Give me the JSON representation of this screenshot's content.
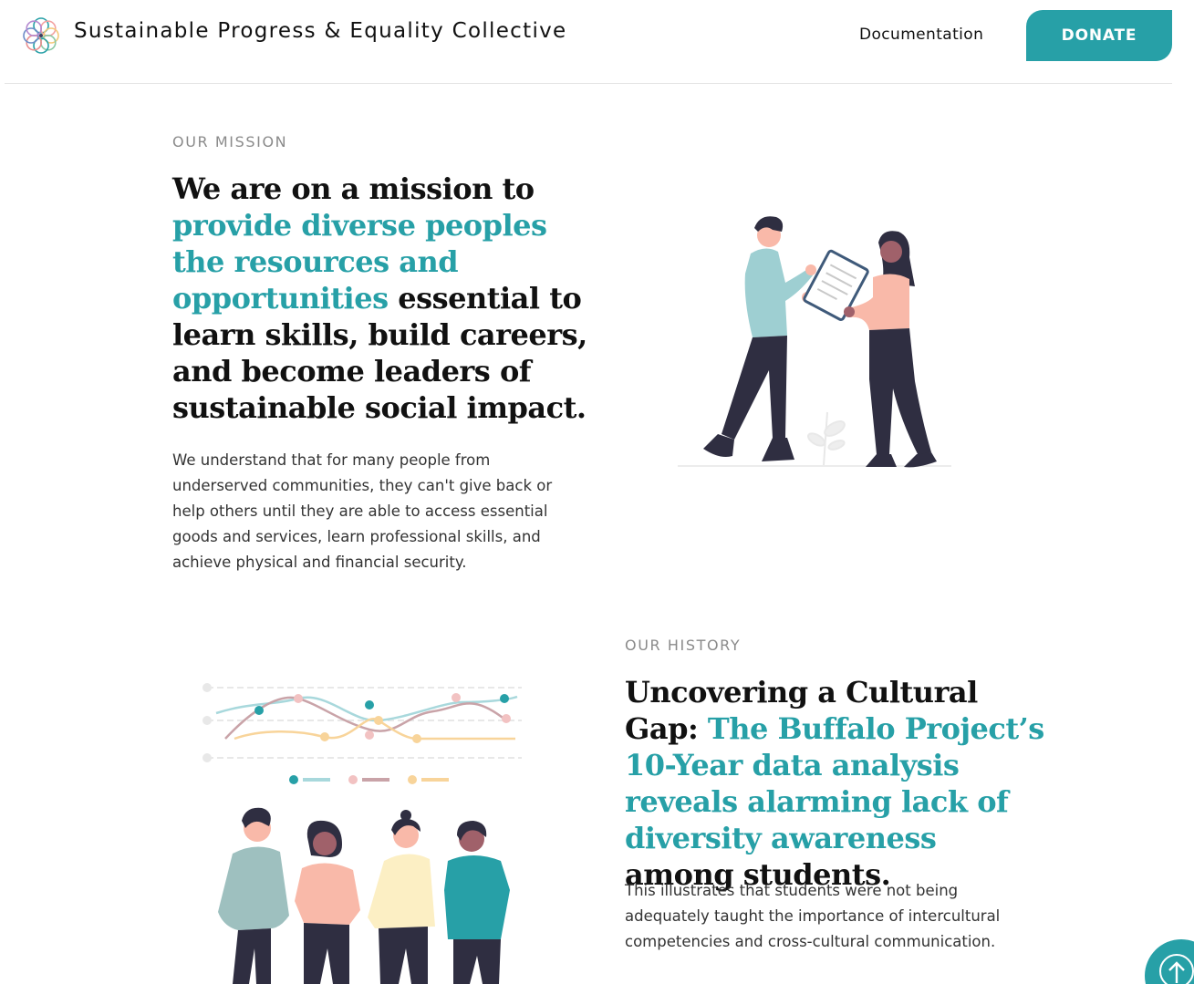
{
  "header": {
    "brand_name": "Sustainable Progress & Equality Collective",
    "nav_documentation": "Documentation",
    "donate_label": "DONATE",
    "logo_icon": "rosette-logo-icon"
  },
  "mission": {
    "eyebrow": "OUR MISSION",
    "heading_lead": "We are on a mission to",
    "heading_accent": "provide diverse peoples the resources and opportunities",
    "heading_tail": "essential to learn skills, build careers, and become leaders of sustainable social impact.",
    "body": "We understand that for many people from underserved communities, they can't give back or help others until they are able to access essential goods and services, learn professional skills, and achieve physical and financial security.",
    "illustration": "two-people-reviewing-document-illustration"
  },
  "history": {
    "eyebrow": "OUR HISTORY",
    "heading_lead": "Uncovering a Cultural Gap:",
    "heading_accent": "The Buffalo Project’s 10-Year data analysis reveals alarming lack of diversity awareness",
    "heading_tail": "among students.",
    "body": "This illustrates that students were not being adequately taught the importance of intercultural competencies and cross-cultural communication.",
    "illustration": "four-people-with-line-chart-illustration"
  },
  "scroll_top": {
    "icon": "arrow-up-circle-icon"
  },
  "colors": {
    "accent": "#27a0a7",
    "heading": "#111111",
    "body": "#333333",
    "eyebrow": "#8a8a8a"
  }
}
